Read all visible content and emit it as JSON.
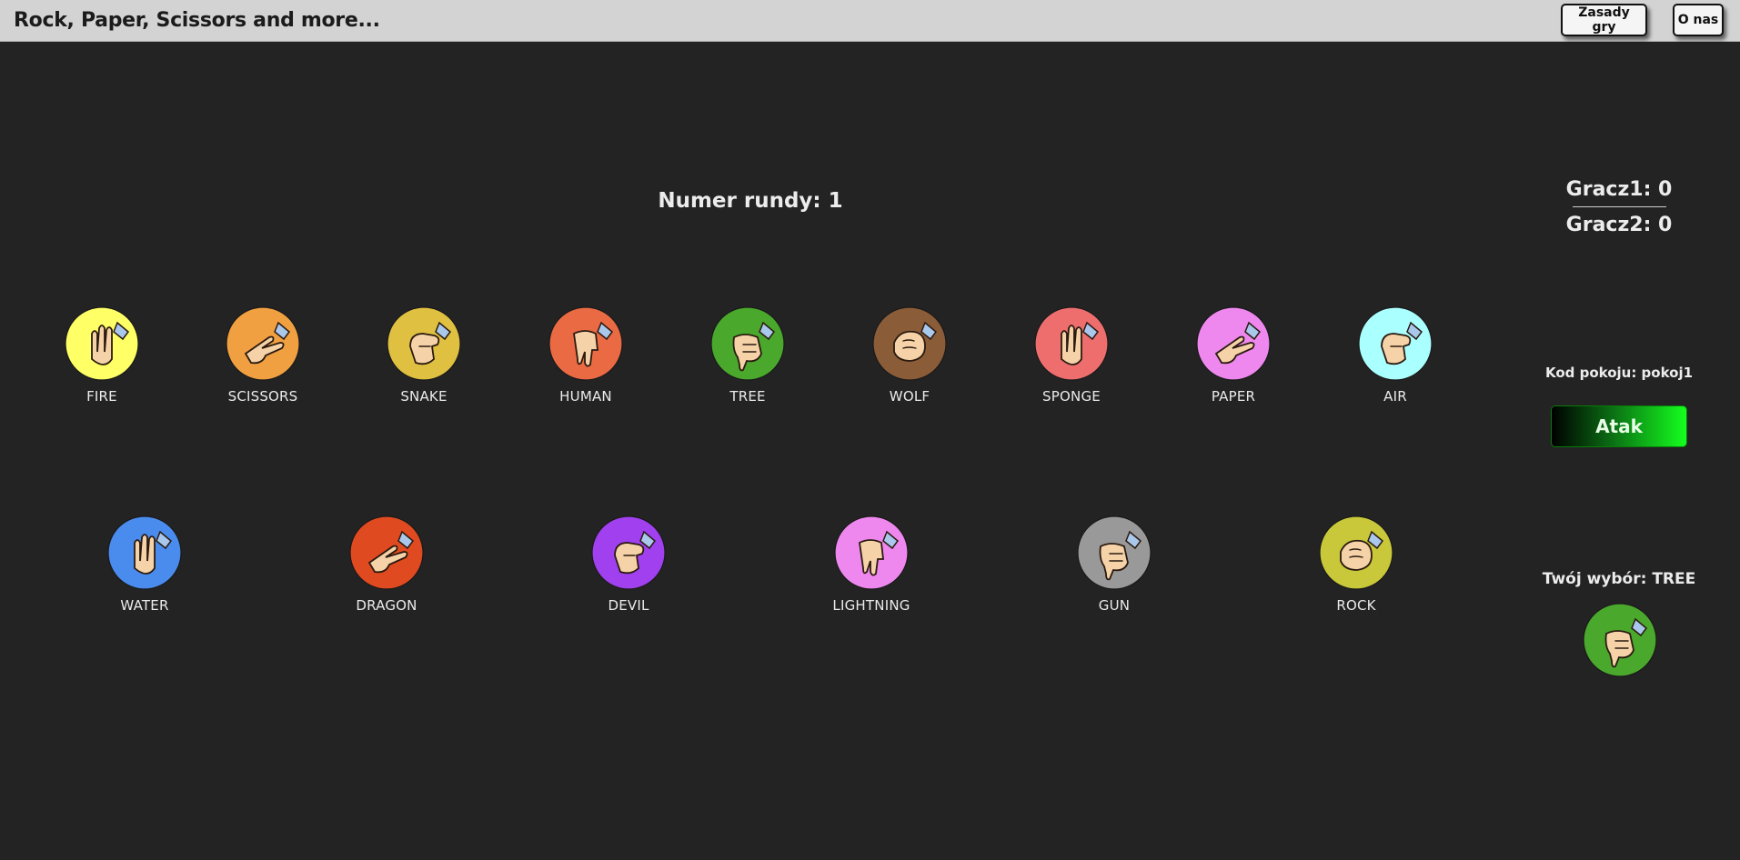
{
  "app": {
    "title": "Rock, Paper, Scissors and more...",
    "nav": {
      "rules_label": "Zasady gry",
      "about_label": "O nas"
    }
  },
  "game": {
    "round_label": "Numer rundy: 1",
    "scores": {
      "player1": "Gracz1: 0",
      "player2": "Gracz2: 0"
    },
    "room_label": "Kod pokoju: pokoj1",
    "attack_label": "Atak",
    "choice_label": "Twój wybór: TREE",
    "choice_color": "#4aa82c",
    "choices_row1": [
      {
        "label": "FIRE",
        "color": "#ffff66",
        "icon": "fire-hand-icon"
      },
      {
        "label": "SCISSORS",
        "color": "#f0a040",
        "icon": "scissors-hand-icon"
      },
      {
        "label": "SNAKE",
        "color": "#e0c040",
        "icon": "snake-hand-icon"
      },
      {
        "label": "HUMAN",
        "color": "#ea6a44",
        "icon": "human-hand-icon"
      },
      {
        "label": "TREE",
        "color": "#4aa82c",
        "icon": "tree-hand-icon"
      },
      {
        "label": "WOLF",
        "color": "#8a5c38",
        "icon": "wolf-hand-icon"
      },
      {
        "label": "SPONGE",
        "color": "#ee6e6e",
        "icon": "sponge-hand-icon"
      },
      {
        "label": "PAPER",
        "color": "#ee88ee",
        "icon": "paper-hand-icon"
      },
      {
        "label": "AIR",
        "color": "#aaffff",
        "icon": "air-hand-icon"
      }
    ],
    "choices_row2": [
      {
        "label": "WATER",
        "color": "#4a8cee",
        "icon": "water-hand-icon"
      },
      {
        "label": "DRAGON",
        "color": "#e04a20",
        "icon": "dragon-hand-icon"
      },
      {
        "label": "DEVIL",
        "color": "#a040ee",
        "icon": "devil-hand-icon"
      },
      {
        "label": "LIGHTNING",
        "color": "#ee88ee",
        "icon": "lightning-hand-icon"
      },
      {
        "label": "GUN",
        "color": "#999999",
        "icon": "gun-hand-icon"
      },
      {
        "label": "ROCK",
        "color": "#c8c83a",
        "icon": "rock-hand-icon"
      }
    ]
  }
}
